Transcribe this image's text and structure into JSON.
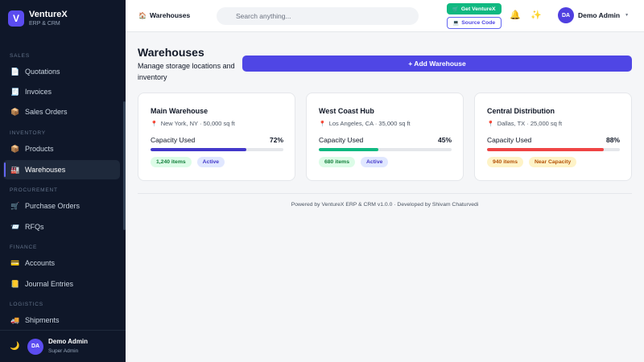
{
  "brand": {
    "logo_letter": "V",
    "name": "VentureX",
    "subtitle": "ERP & CRM",
    "color": "#5b4cf0"
  },
  "sidebar": {
    "sections": {
      "sales": "SALES",
      "inventory": "INVENTORY",
      "procurement": "PROCUREMENT",
      "finance": "FINANCE",
      "logistics": "LOGISTICS"
    },
    "items": [
      {
        "label": "Quotations",
        "icon": "document-icon",
        "glyph": "📄"
      },
      {
        "label": "Invoices",
        "icon": "invoice-icon",
        "glyph": "🧾"
      },
      {
        "label": "Sales Orders",
        "icon": "box-icon",
        "glyph": "📦"
      },
      {
        "label": "Products",
        "icon": "package-icon",
        "glyph": "📦"
      },
      {
        "label": "Warehouses",
        "icon": "factory-icon",
        "glyph": "🏭",
        "active": true
      },
      {
        "label": "Purchase Orders",
        "icon": "cart-icon",
        "glyph": "🛒"
      },
      {
        "label": "RFQs",
        "icon": "mail-icon",
        "glyph": "📨"
      },
      {
        "label": "Accounts",
        "icon": "card-icon",
        "glyph": "💳"
      },
      {
        "label": "Journal Entries",
        "icon": "journal-icon",
        "glyph": "📒"
      },
      {
        "label": "Shipments",
        "icon": "truck-icon",
        "glyph": "🚚"
      }
    ],
    "footer": {
      "theme_glyph": "🌙",
      "avatar": "DA",
      "name": "Demo Admin",
      "role": "Super Admin"
    }
  },
  "header": {
    "breadcrumb": "Warehouses",
    "breadcrumb_glyph": "🏠",
    "search_placeholder": "Search anything...",
    "get_button": "Get VentureX",
    "source_button": "Source Code",
    "bell_glyph": "🔔",
    "sparkle_glyph": "✨",
    "user_avatar": "DA",
    "user_name": "Demo Admin",
    "caret": "▼"
  },
  "page": {
    "title": "Warehouses",
    "subtitle": "Manage storage locations and inventory",
    "add_button": "+ Add Warehouse"
  },
  "warehouses": [
    {
      "name": "Main Warehouse",
      "location": "New York, NY · 50,000 sq ft",
      "capacity_label": "Capacity Used",
      "capacity_pct": 72,
      "capacity_text": "72%",
      "bar_color": "#4338ca",
      "items_badge": "1,240 items",
      "status_badge": "Active",
      "status_tone": "blue"
    },
    {
      "name": "West Coast Hub",
      "location": "Los Angeles, CA · 35,000 sq ft",
      "capacity_label": "Capacity Used",
      "capacity_pct": 45,
      "capacity_text": "45%",
      "bar_color": "#10b981",
      "items_badge": "680 items",
      "status_badge": "Active",
      "status_tone": "blue"
    },
    {
      "name": "Central Distribution",
      "location": "Dallas, TX · 25,000 sq ft",
      "capacity_label": "Capacity Used",
      "capacity_pct": 88,
      "capacity_text": "88%",
      "bar_color": "#ef4444",
      "items_badge": "940 items",
      "status_badge": "Near Capacity",
      "status_tone": "amber"
    }
  ],
  "footer": {
    "text": "Powered by VentureX ERP & CRM v1.0.0 · Developed by Shivam Chaturvedi"
  }
}
